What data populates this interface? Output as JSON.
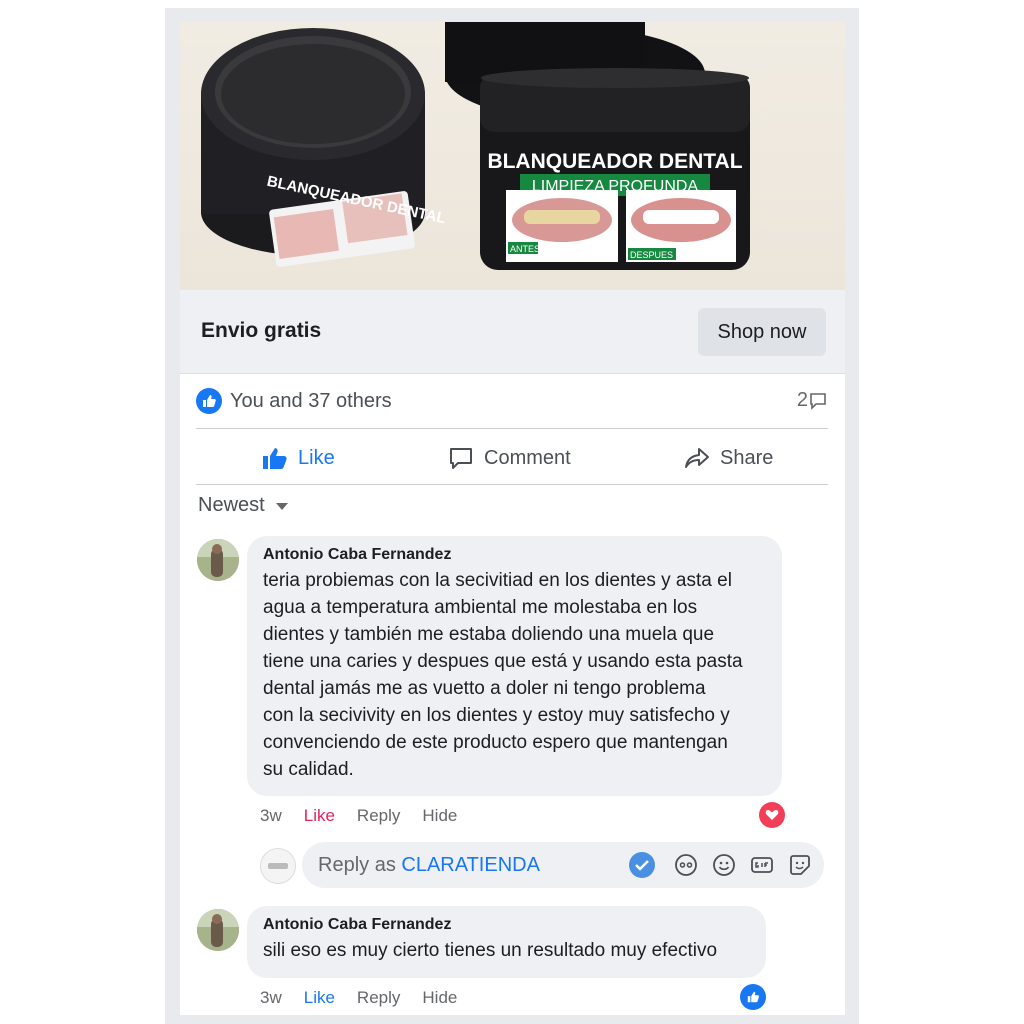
{
  "ad": {
    "product_label": "BLANQUEADOR DENTAL",
    "product_sublabel": "LIMPIEZA PROFUNDA",
    "left_jar_label": "BLANQUEADOR DENTAL",
    "before_label": "ANTES",
    "after_label": "DESPUES",
    "headline": "Envio gratis",
    "cta": "Shop now"
  },
  "reactions": {
    "summary": "You and 37 others",
    "comment_count": "2"
  },
  "actions": {
    "like": "Like",
    "comment": "Comment",
    "share": "Share"
  },
  "sort": {
    "label": "Newest"
  },
  "comments": [
    {
      "author": "Antonio Caba Fernandez",
      "text": "teria probiemas con la secivitiad en los dientes y asta el\nagua a temperatura ambiental me molestaba en los\ndientes y también me estaba doliendo una muela que\ntiene una caries y despues que está y usando esta pasta\ndental jamás me as vuetto a doler ni tengo problema\ncon la secivivity en los dientes y estoy muy satisfecho y\nconvenciendo de este producto espero que mantengan\nsu calidad.",
      "time": "3w",
      "like": "Like",
      "reply": "Reply",
      "hide": "Hide"
    },
    {
      "author": "Antonio Caba Fernandez",
      "text": "sili eso es muy cierto tienes un resultado muy efectivo",
      "time": "3w",
      "like": "Like",
      "reply": "Reply",
      "hide": "Hide"
    }
  ],
  "reply": {
    "prefix": "Reply as ",
    "page_name": "CLARATIENDA"
  },
  "colors": {
    "accent": "#1877f2",
    "like_red": "#e0245e",
    "bubble": "#eef0f4"
  }
}
